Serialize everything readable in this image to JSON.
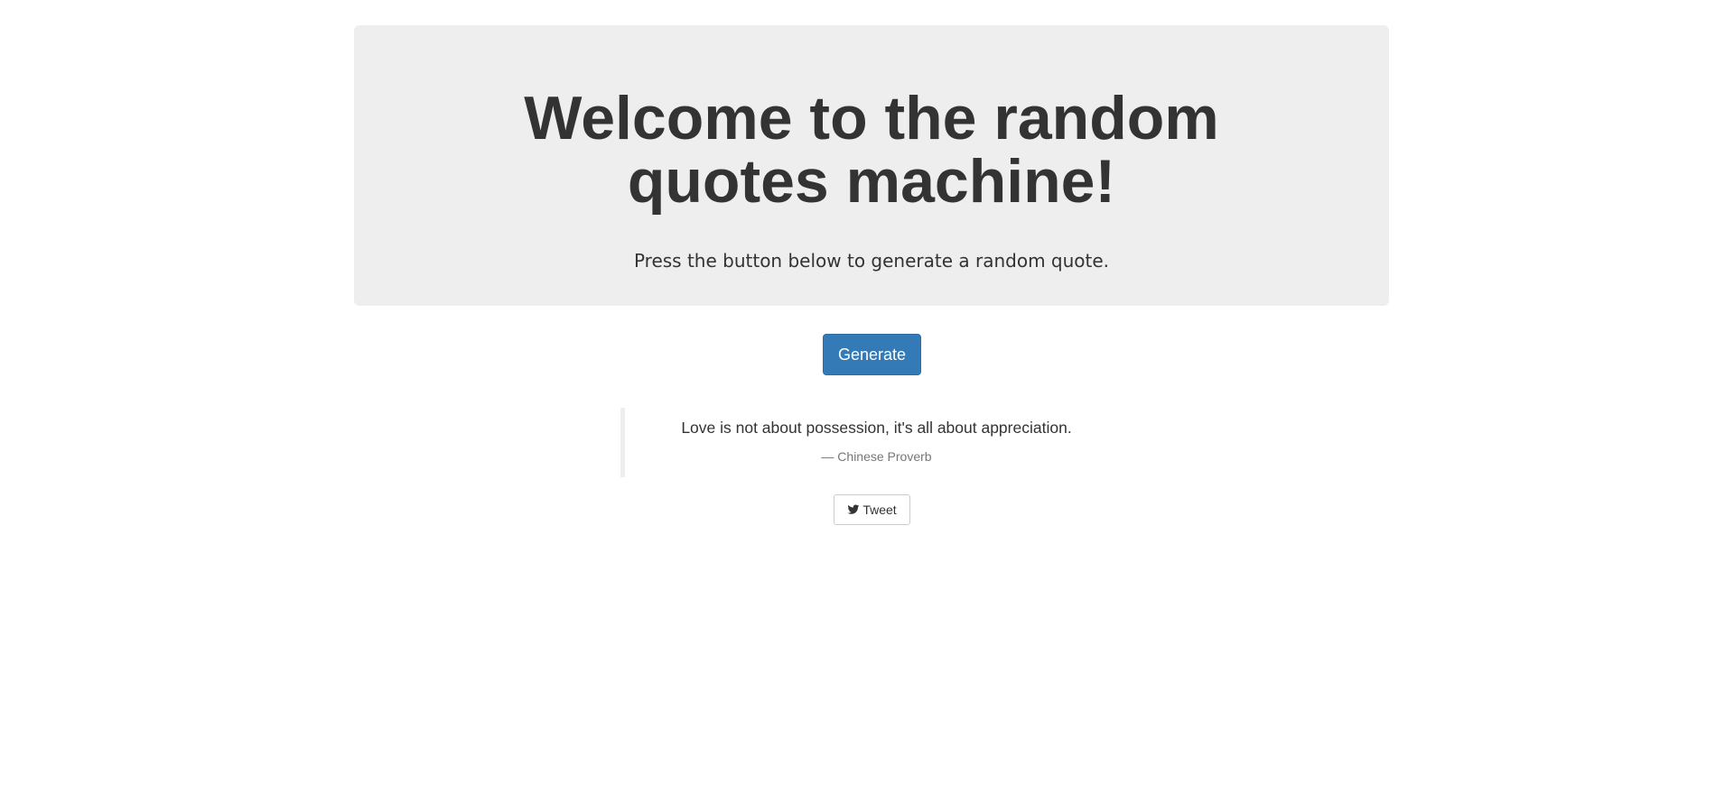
{
  "header": {
    "title": "Welcome to the random quotes machine!",
    "subtitle": "Press the button below to generate a random quote."
  },
  "generate_button": {
    "label": "Generate",
    "color": "#337ab7"
  },
  "quote": {
    "text": "Love is not about possession, it's all about appreciation.",
    "author": "— Chinese Proverb"
  },
  "tweet_button": {
    "label": "Tweet",
    "icon": "twitter-icon"
  }
}
